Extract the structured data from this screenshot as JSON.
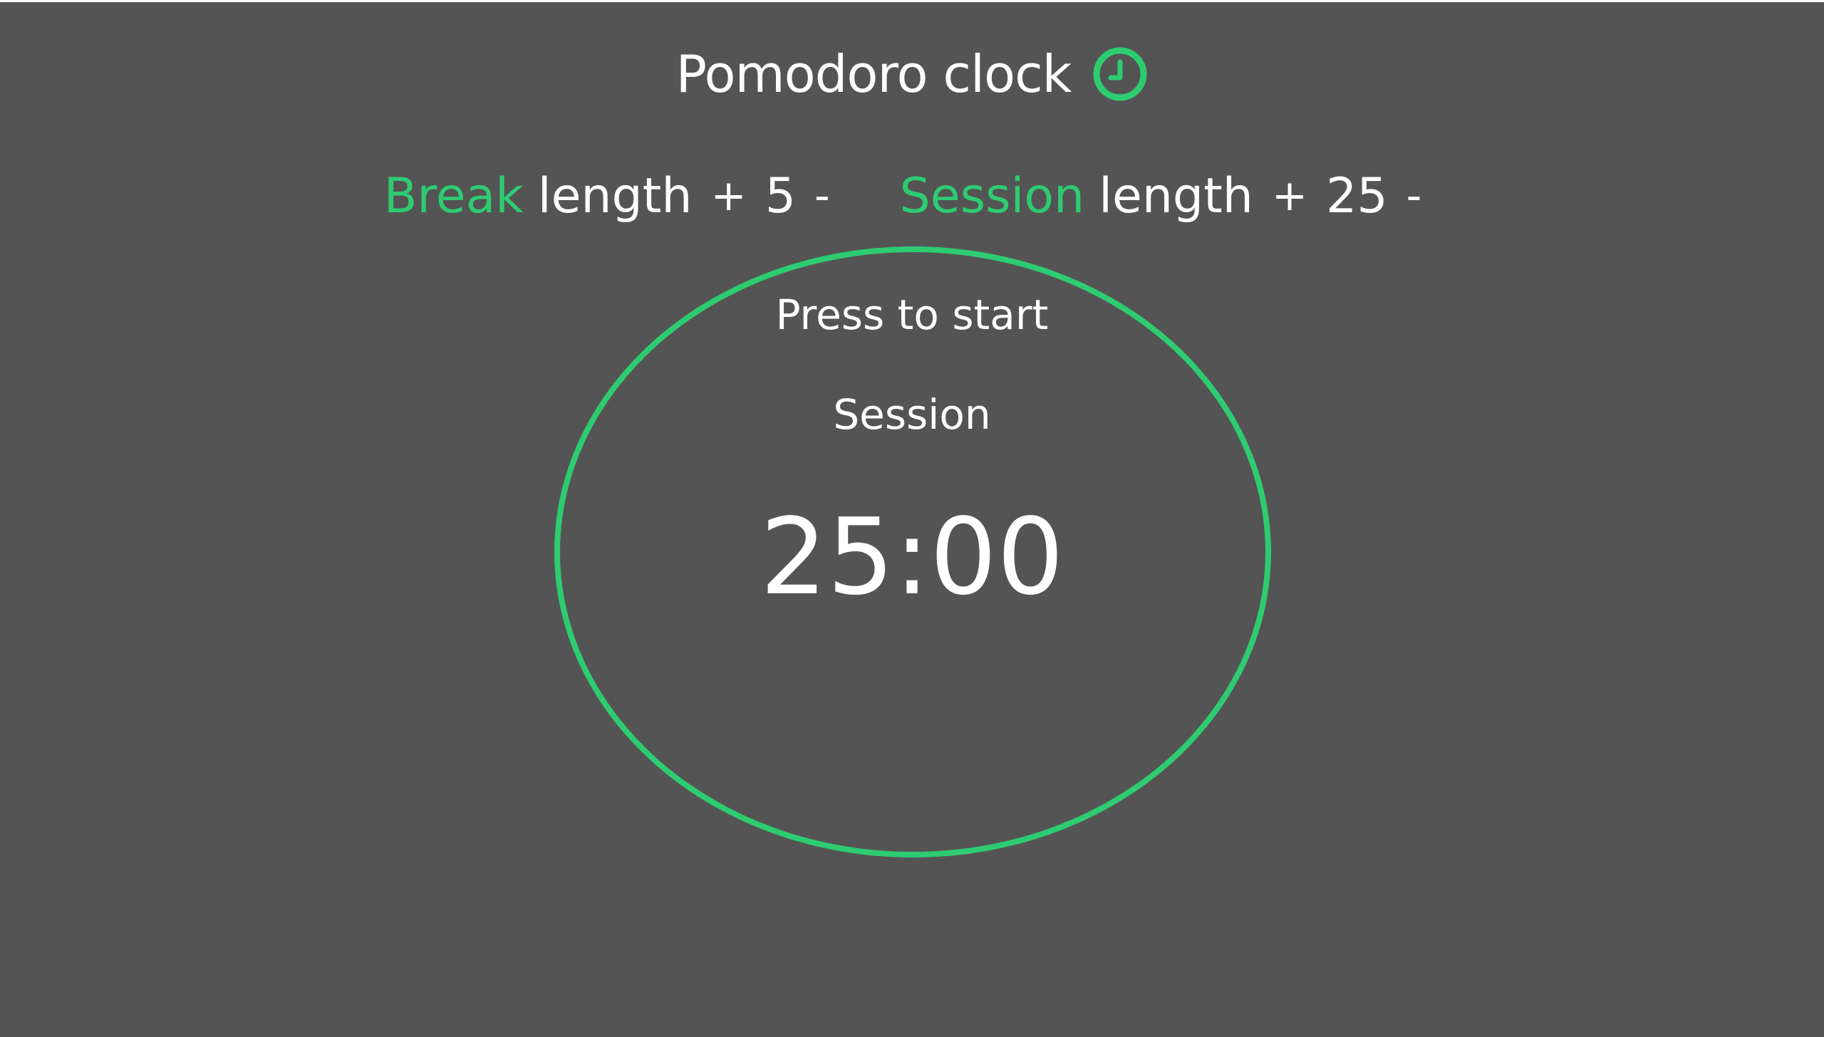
{
  "header": {
    "title": "Pomodoro clock",
    "icon": "clock-icon",
    "accent_color": "#2ecc71"
  },
  "break_control": {
    "accent_label": "Break",
    "label": "length",
    "increment_label": "+",
    "value": "5",
    "decrement_label": "-"
  },
  "session_control": {
    "accent_label": "Session",
    "label": "length",
    "increment_label": "+",
    "value": "25",
    "decrement_label": "-"
  },
  "timer": {
    "prompt": "Press to start",
    "mode": "Session",
    "time": "25:00"
  }
}
